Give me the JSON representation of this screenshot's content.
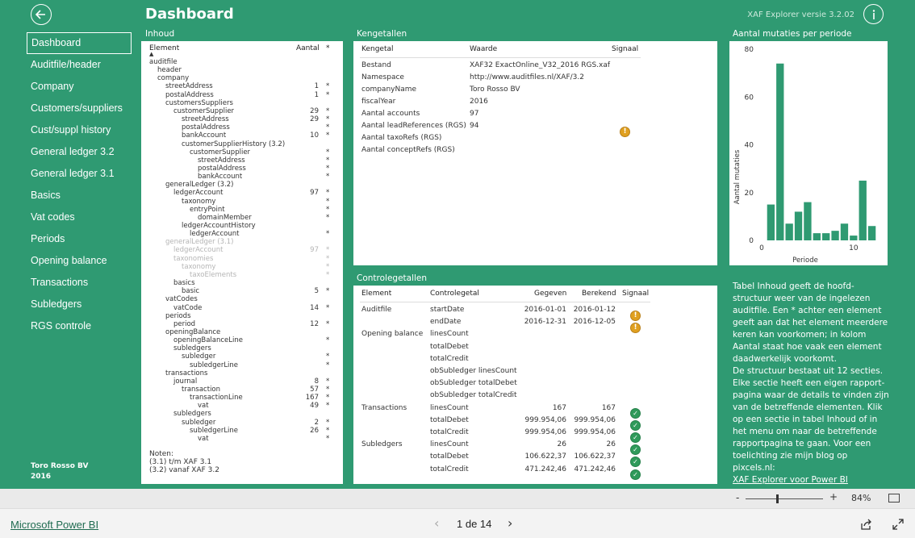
{
  "header": {
    "title": "Dashboard",
    "version": "XAF Explorer versie 3.2.02"
  },
  "nav": {
    "items": [
      "Dashboard",
      "Auditfile/header",
      "Company",
      "Customers/suppliers",
      "Cust/suppl history",
      "General ledger 3.2",
      "General ledger 3.1",
      "Basics",
      "Vat codes",
      "Periods",
      "Opening balance",
      "Transactions",
      "Subledgers",
      "RGS controle"
    ]
  },
  "company": {
    "name": "Toro Rosso BV",
    "year": "2016"
  },
  "inhoud": {
    "title": "Inhoud",
    "col_element": "Element",
    "col_aantal": "Aantal",
    "col_star": "*",
    "rows": [
      {
        "name": "auditfile",
        "level": 0,
        "count": "",
        "star": "",
        "faded": false
      },
      {
        "name": "header",
        "level": 1,
        "count": "",
        "star": "",
        "faded": false
      },
      {
        "name": "company",
        "level": 1,
        "count": "",
        "star": "",
        "faded": false
      },
      {
        "name": "streetAddress",
        "level": 2,
        "count": "1",
        "star": "*",
        "faded": false
      },
      {
        "name": "postalAddress",
        "level": 2,
        "count": "1",
        "star": "*",
        "faded": false
      },
      {
        "name": "customersSuppliers",
        "level": 2,
        "count": "",
        "star": "",
        "faded": false
      },
      {
        "name": "customerSupplier",
        "level": 3,
        "count": "29",
        "star": "*",
        "faded": false
      },
      {
        "name": "streetAddress",
        "level": 4,
        "count": "29",
        "star": "*",
        "faded": false
      },
      {
        "name": "postalAddress",
        "level": 4,
        "count": "",
        "star": "*",
        "faded": false
      },
      {
        "name": "bankAccount",
        "level": 4,
        "count": "10",
        "star": "*",
        "faded": false
      },
      {
        "name": "customerSupplierHistory (3.2)",
        "level": 4,
        "count": "",
        "star": "",
        "faded": false
      },
      {
        "name": "customerSupplier",
        "level": 5,
        "count": "",
        "star": "*",
        "faded": false
      },
      {
        "name": "streetAddress",
        "level": 6,
        "count": "",
        "star": "*",
        "faded": false
      },
      {
        "name": "postalAddress",
        "level": 6,
        "count": "",
        "star": "*",
        "faded": false
      },
      {
        "name": "bankAccount",
        "level": 6,
        "count": "",
        "star": "*",
        "faded": false
      },
      {
        "name": "generalLedger (3.2)",
        "level": 2,
        "count": "",
        "star": "",
        "faded": false
      },
      {
        "name": "ledgerAccount",
        "level": 3,
        "count": "97",
        "star": "*",
        "faded": false
      },
      {
        "name": "taxonomy",
        "level": 4,
        "count": "",
        "star": "*",
        "faded": false
      },
      {
        "name": "entryPoint",
        "level": 5,
        "count": "",
        "star": "*",
        "faded": false
      },
      {
        "name": "domainMember",
        "level": 6,
        "count": "",
        "star": "*",
        "faded": false
      },
      {
        "name": "ledgerAccountHistory",
        "level": 4,
        "count": "",
        "star": "",
        "faded": false
      },
      {
        "name": "ledgerAccount",
        "level": 5,
        "count": "",
        "star": "*",
        "faded": false
      },
      {
        "name": "generalLedger (3.1)",
        "level": 2,
        "count": "",
        "star": "",
        "faded": true
      },
      {
        "name": "ledgerAccount",
        "level": 3,
        "count": "97",
        "star": "*",
        "faded": true
      },
      {
        "name": "taxonomies",
        "level": 3,
        "count": "",
        "star": "*",
        "faded": true
      },
      {
        "name": "taxonomy",
        "level": 4,
        "count": "",
        "star": "*",
        "faded": true
      },
      {
        "name": "taxoElements",
        "level": 5,
        "count": "",
        "star": "*",
        "faded": true
      },
      {
        "name": "basics",
        "level": 3,
        "count": "",
        "star": "",
        "faded": false
      },
      {
        "name": "basic",
        "level": 4,
        "count": "5",
        "star": "*",
        "faded": false
      },
      {
        "name": "vatCodes",
        "level": 2,
        "count": "",
        "star": "",
        "faded": false
      },
      {
        "name": "vatCode",
        "level": 3,
        "count": "14",
        "star": "*",
        "faded": false
      },
      {
        "name": "periods",
        "level": 2,
        "count": "",
        "star": "",
        "faded": false
      },
      {
        "name": "period",
        "level": 3,
        "count": "12",
        "star": "*",
        "faded": false
      },
      {
        "name": "openingBalance",
        "level": 2,
        "count": "",
        "star": "",
        "faded": false
      },
      {
        "name": "openingBalanceLine",
        "level": 3,
        "count": "",
        "star": "*",
        "faded": false
      },
      {
        "name": "subledgers",
        "level": 3,
        "count": "",
        "star": "",
        "faded": false
      },
      {
        "name": "subledger",
        "level": 4,
        "count": "",
        "star": "*",
        "faded": false
      },
      {
        "name": "subledgerLine",
        "level": 5,
        "count": "",
        "star": "*",
        "faded": false
      },
      {
        "name": "transactions",
        "level": 2,
        "count": "",
        "star": "",
        "faded": false
      },
      {
        "name": "journal",
        "level": 3,
        "count": "8",
        "star": "*",
        "faded": false
      },
      {
        "name": "transaction",
        "level": 4,
        "count": "57",
        "star": "*",
        "faded": false
      },
      {
        "name": "transactionLine",
        "level": 5,
        "count": "167",
        "star": "*",
        "faded": false
      },
      {
        "name": "vat",
        "level": 6,
        "count": "49",
        "star": "*",
        "faded": false
      },
      {
        "name": "subledgers",
        "level": 3,
        "count": "",
        "star": "",
        "faded": false
      },
      {
        "name": "subledger",
        "level": 4,
        "count": "2",
        "star": "*",
        "faded": false
      },
      {
        "name": "subledgerLine",
        "level": 5,
        "count": "26",
        "star": "*",
        "faded": false
      },
      {
        "name": "vat",
        "level": 6,
        "count": "",
        "star": "*",
        "faded": false
      }
    ],
    "notes_title": "Noten:",
    "notes": [
      "(3.1) t/m XAF 3.1",
      "(3.2) vanaf XAF 3.2"
    ]
  },
  "kengetallen": {
    "title": "Kengetallen",
    "col_kengetal": "Kengetal",
    "col_waarde": "Waarde",
    "col_signaal": "Signaal",
    "rows": [
      {
        "label": "Bestand",
        "value": "XAF32 ExactOnline_V32_2016 RGS.xaf",
        "signal": ""
      },
      {
        "label": "Namespace",
        "value": "http://www.auditfiles.nl/XAF/3.2",
        "signal": ""
      },
      {
        "label": "companyName",
        "value": "Toro Rosso BV",
        "signal": ""
      },
      {
        "label": "fiscalYear",
        "value": "2016",
        "signal": ""
      },
      {
        "label": "Aantal accounts",
        "value": "97",
        "signal": ""
      },
      {
        "label": "Aantal leadReferences (RGS)",
        "value": "94",
        "signal": "warn"
      },
      {
        "label": "Aantal taxoRefs (RGS)",
        "value": "",
        "signal": ""
      },
      {
        "label": "Aantal conceptRefs (RGS)",
        "value": "",
        "signal": ""
      }
    ]
  },
  "controle": {
    "title": "Controlegetallen",
    "col_element": "Element",
    "col_controlegetal": "Controlegetal",
    "col_gegeven": "Gegeven",
    "col_berekend": "Berekend",
    "col_signaal": "Signaal",
    "rows": [
      {
        "element": "Auditfile",
        "getal": "startDate",
        "gegeven": "2016-01-01",
        "berekend": "2016-01-12",
        "signal": "warn"
      },
      {
        "element": "",
        "getal": "endDate",
        "gegeven": "2016-12-31",
        "berekend": "2016-12-05",
        "signal": "warn"
      },
      {
        "element": "Opening balance",
        "getal": "linesCount",
        "gegeven": "",
        "berekend": "",
        "signal": ""
      },
      {
        "element": "",
        "getal": "totalDebet",
        "gegeven": "",
        "berekend": "",
        "signal": ""
      },
      {
        "element": "",
        "getal": "totalCredit",
        "gegeven": "",
        "berekend": "",
        "signal": ""
      },
      {
        "element": "",
        "getal": "obSubledger linesCount",
        "gegeven": "",
        "berekend": "",
        "signal": ""
      },
      {
        "element": "",
        "getal": "obSubledger totalDebet",
        "gegeven": "",
        "berekend": "",
        "signal": ""
      },
      {
        "element": "",
        "getal": "obSubledger totalCredit",
        "gegeven": "",
        "berekend": "",
        "signal": ""
      },
      {
        "element": "Transactions",
        "getal": "linesCount",
        "gegeven": "167",
        "berekend": "167",
        "signal": "ok"
      },
      {
        "element": "",
        "getal": "totalDebet",
        "gegeven": "999.954,06",
        "berekend": "999.954,06",
        "signal": "ok"
      },
      {
        "element": "",
        "getal": "totalCredit",
        "gegeven": "999.954,06",
        "berekend": "999.954,06",
        "signal": "ok"
      },
      {
        "element": "Subledgers",
        "getal": "linesCount",
        "gegeven": "26",
        "berekend": "26",
        "signal": "ok"
      },
      {
        "element": "",
        "getal": "totalDebet",
        "gegeven": "106.622,37",
        "berekend": "106.622,37",
        "signal": "ok"
      },
      {
        "element": "",
        "getal": "totalCredit",
        "gegeven": "471.242,46",
        "berekend": "471.242,46",
        "signal": "ok"
      }
    ]
  },
  "chart_title": "Aantal mutaties per periode",
  "chart_data": {
    "type": "bar",
    "title": "Aantal mutaties per periode",
    "xlabel": "Periode",
    "ylabel": "Aantal mutaties",
    "categories": [
      1,
      2,
      3,
      4,
      5,
      6,
      7,
      8,
      9,
      10,
      11,
      12
    ],
    "values": [
      15,
      74,
      7,
      12,
      16,
      3,
      3,
      4,
      7,
      2,
      25,
      6
    ],
    "ylim": [
      0,
      80
    ],
    "yticks": [
      0,
      20,
      40,
      60,
      80
    ],
    "xticks": [
      0,
      10
    ],
    "xlim": [
      0,
      13
    ],
    "bar_color": "#2f9a72"
  },
  "description": {
    "text": "Tabel Inhoud geeft de hoofd-structuur weer van de ingelezen auditfile. Een * achter een element geeft aan dat het element meerdere keren kan voorkomen; in kolom Aantal staat hoe vaak een element daadwerkelijk voorkomt.\nDe structuur bestaat uit 12 secties. Elke sectie heeft een eigen rapport-pagina waar de details te vinden zijn van de betreffende elementen. Klik op een sectie in tabel Inhoud of in het menu om naar de betreffende rapportpagina te gaan. Voor een toelichting zie mijn blog op pixcels.nl:",
    "link": "XAF Explorer voor Power BI"
  },
  "zoom": {
    "minus": "-",
    "plus": "+",
    "level": "84%"
  },
  "footer": {
    "brand": "Microsoft Power BI",
    "page": "1 de 14",
    "prev": "‹",
    "next": "›"
  },
  "colors": {
    "brand_green": "#2f9a72",
    "warn": "#e0a020",
    "ok": "#2f9a5a"
  }
}
